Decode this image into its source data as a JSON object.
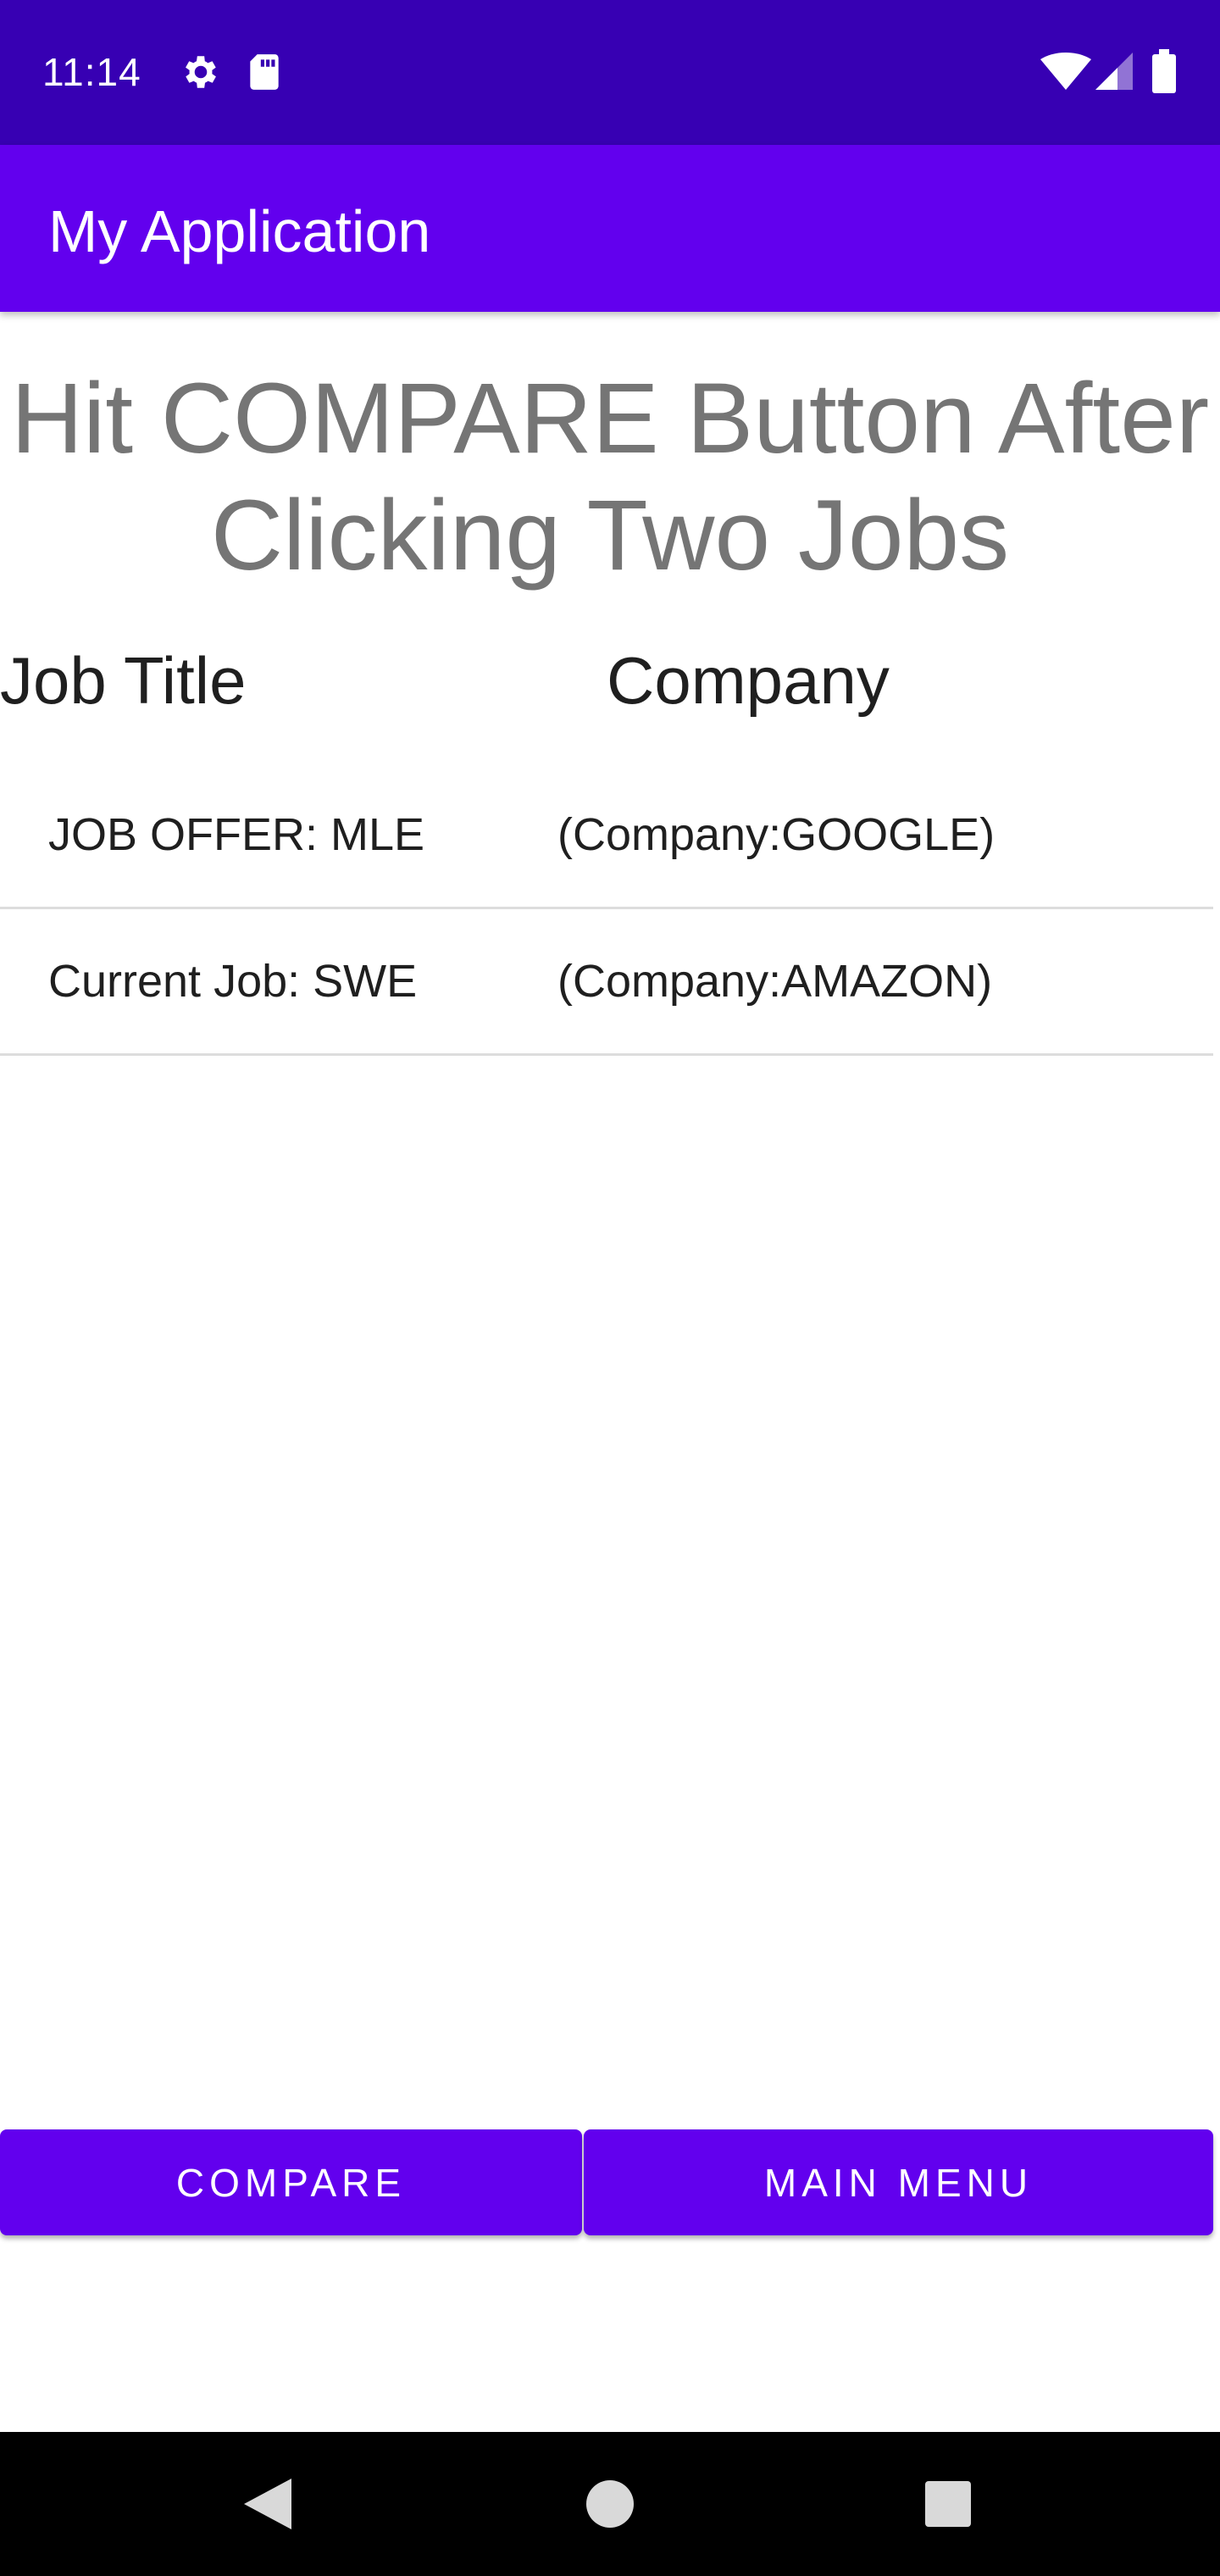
{
  "status_bar": {
    "time": "11:14",
    "icons": [
      "gear-icon",
      "sd-card-icon",
      "wifi-icon",
      "signal-icon",
      "battery-icon"
    ],
    "background": "#3700b3"
  },
  "app_bar": {
    "title": "My Application",
    "background": "#6200ee"
  },
  "instruction": "Hit COMPARE Button After\nClicking Two Jobs",
  "columns": {
    "job_title": "Job Title",
    "company": "Company"
  },
  "jobs": [
    {
      "title": "JOB OFFER: MLE",
      "company": "(Company:GOOGLE)"
    },
    {
      "title": "Current Job: SWE",
      "company": "(Company:AMAZON)"
    }
  ],
  "buttons": {
    "compare": "COMPARE",
    "main_menu": "MAIN MENU"
  },
  "nav_bar": {
    "icons": [
      "back-icon",
      "home-icon",
      "recents-icon"
    ]
  }
}
